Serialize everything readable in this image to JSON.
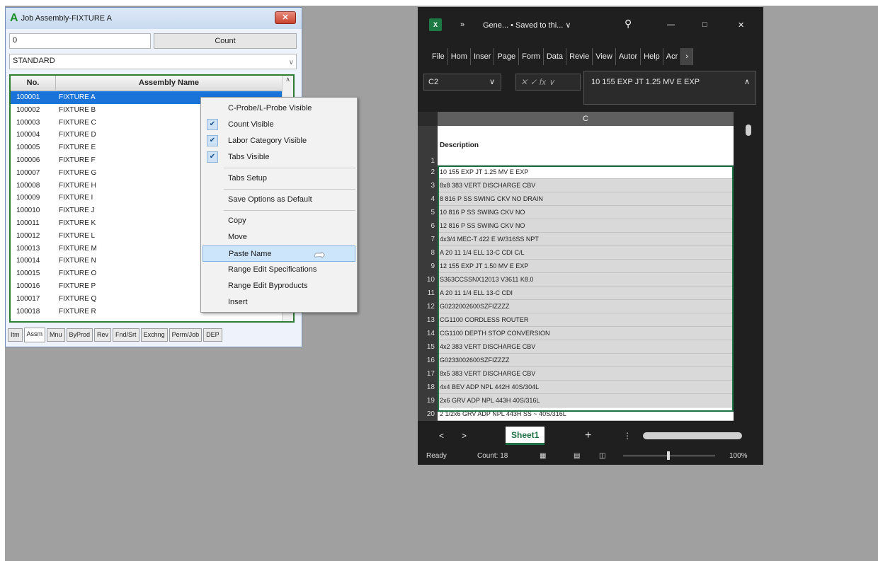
{
  "app": {
    "title": "Job Assembly-FIXTURE A",
    "logo": "A",
    "close_label": "✕",
    "count_field_value": "0",
    "count_button": "Count",
    "category_value": "STANDARD",
    "grid": {
      "headers": [
        "No.",
        "Assembly Name"
      ],
      "rows": [
        {
          "no": "100001",
          "name": "FIXTURE A"
        },
        {
          "no": "100002",
          "name": "FIXTURE B"
        },
        {
          "no": "100003",
          "name": "FIXTURE C"
        },
        {
          "no": "100004",
          "name": "FIXTURE D"
        },
        {
          "no": "100005",
          "name": "FIXTURE E"
        },
        {
          "no": "100006",
          "name": "FIXTURE F"
        },
        {
          "no": "100007",
          "name": "FIXTURE G"
        },
        {
          "no": "100008",
          "name": "FIXTURE H"
        },
        {
          "no": "100009",
          "name": "FIXTURE I"
        },
        {
          "no": "100010",
          "name": "FIXTURE J"
        },
        {
          "no": "100011",
          "name": "FIXTURE K"
        },
        {
          "no": "100012",
          "name": "FIXTURE L"
        },
        {
          "no": "100013",
          "name": "FIXTURE M"
        },
        {
          "no": "100014",
          "name": "FIXTURE N"
        },
        {
          "no": "100015",
          "name": "FIXTURE O"
        },
        {
          "no": "100016",
          "name": "FIXTURE P"
        },
        {
          "no": "100017",
          "name": "FIXTURE Q"
        },
        {
          "no": "100018",
          "name": "FIXTURE R"
        }
      ]
    },
    "tabs": [
      "Itm",
      "Assm",
      "Mnu",
      "ByProd",
      "Rev",
      "Fnd/Srt",
      "Exchng",
      "Perm/Job",
      "DEP"
    ]
  },
  "context_menu": {
    "items": [
      {
        "label": "C-Probe/L-Probe Visible",
        "checked": false
      },
      {
        "label": "Count Visible",
        "checked": true
      },
      {
        "label": "Labor Category Visible",
        "checked": true
      },
      {
        "label": "Tabs Visible",
        "checked": true
      },
      {
        "label": "Tabs Setup",
        "checked": false
      },
      {
        "label": "Save Options as Default",
        "checked": false
      },
      {
        "label": "Copy",
        "checked": false
      },
      {
        "label": "Move",
        "checked": false
      },
      {
        "label": "Paste Name",
        "checked": false,
        "highlighted": true
      },
      {
        "label": "Range Edit Specifications",
        "checked": false
      },
      {
        "label": "Range Edit Byproducts",
        "checked": false
      },
      {
        "label": "Insert",
        "checked": false
      }
    ]
  },
  "excel": {
    "file_title": "Gene... • Saved to thi... ∨",
    "ribbon_tabs": [
      "File",
      "Hom",
      "Inser",
      "Page",
      "Form",
      "Data",
      "Revie",
      "View",
      "Autor",
      "Help",
      "Acr"
    ],
    "name_box": "C2",
    "fx_label": "fx",
    "formula_value": "10 155 EXP JT 1.25 MV E EXP",
    "column_header": "C",
    "rows": [
      {
        "n": "1",
        "text": "Description"
      },
      {
        "n": "2",
        "text": "10 155 EXP JT 1.25 MV E EXP"
      },
      {
        "n": "3",
        "text": "8x8 383 VERT DISCHARGE CBV"
      },
      {
        "n": "4",
        "text": "8 816 P SS SWING CKV NO DRAIN"
      },
      {
        "n": "5",
        "text": "10 816 P SS SWING CKV NO"
      },
      {
        "n": "6",
        "text": "12 816 P SS SWING CKV NO"
      },
      {
        "n": "7",
        "text": "4x3/4 MEC-T 422 E W/316SS NPT"
      },
      {
        "n": "8",
        "text": "A 20 11 1/4 ELL 13-C CDI C/L"
      },
      {
        "n": "9",
        "text": "12 155 EXP JT 1.50 MV E EXP"
      },
      {
        "n": "10",
        "text": "S363CCSSNX12013 V3611 K8.0"
      },
      {
        "n": "11",
        "text": "A 20 11 1/4 ELL 13-C CDI"
      },
      {
        "n": "12",
        "text": "G0232002600SZFIZZZZ"
      },
      {
        "n": "13",
        "text": "CG1100 CORDLESS ROUTER"
      },
      {
        "n": "14",
        "text": "CG1100 DEPTH STOP CONVERSION"
      },
      {
        "n": "15",
        "text": "4x2 383 VERT DISCHARGE CBV"
      },
      {
        "n": "16",
        "text": "G0233002600SZFIZZZZ"
      },
      {
        "n": "17",
        "text": "8x5 383 VERT DISCHARGE CBV"
      },
      {
        "n": "18",
        "text": "4x4 BEV ADP NPL 442H 40S/304L"
      },
      {
        "n": "19",
        "text": "2x6 GRV ADP NPL 443H 40S/316L"
      },
      {
        "n": "20",
        "text": "2 1/2x6 GRV ADP NPL 443H SS ~ 40S/316L"
      }
    ],
    "sheet_tab": "Sheet1",
    "status": {
      "ready": "Ready",
      "count": "Count: 18",
      "zoom": "100%"
    }
  }
}
